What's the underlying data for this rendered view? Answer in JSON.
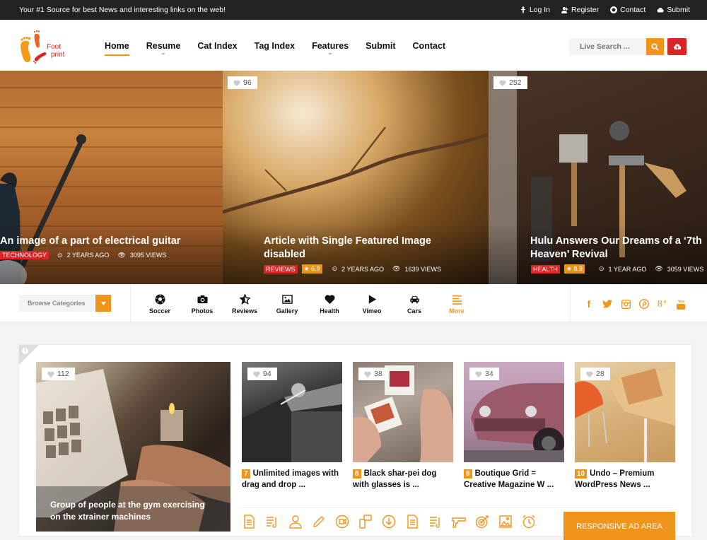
{
  "topbar": {
    "tagline": "Your #1 Source for best News and interesting links on the web!",
    "links": [
      {
        "icon": "login-icon",
        "label": "Log In"
      },
      {
        "icon": "register-icon",
        "label": "Register"
      },
      {
        "icon": "lifebuoy-icon",
        "label": "Contact"
      },
      {
        "icon": "cloud-upload-icon",
        "label": "Submit"
      }
    ]
  },
  "header": {
    "logo": {
      "line1": "Foot",
      "line2": "print"
    },
    "nav": [
      {
        "label": "Home",
        "active": true,
        "dropdown": false
      },
      {
        "label": "Resume",
        "active": false,
        "dropdown": true
      },
      {
        "label": "Cat Index",
        "active": false,
        "dropdown": false
      },
      {
        "label": "Tag Index",
        "active": false,
        "dropdown": false
      },
      {
        "label": "Features",
        "active": false,
        "dropdown": true
      },
      {
        "label": "Submit",
        "active": false,
        "dropdown": false
      },
      {
        "label": "Contact",
        "active": false,
        "dropdown": false
      }
    ],
    "search": {
      "placeholder": "Live Search ...",
      "value": ""
    }
  },
  "hero": [
    {
      "title": "An image of a part of electrical guitar",
      "category": "TECHNOLOGY",
      "rating": null,
      "time": "2 YEARS AGO",
      "views": "3095 VIEWS",
      "likes": null
    },
    {
      "title": "Article with Single Featured Image disabled",
      "category": "REVIEWS",
      "rating": "6.9",
      "time": "2 YEARS AGO",
      "views": "1639 VIEWS",
      "likes": "96"
    },
    {
      "title": "Hulu Answers Our Dreams of a ‘7th Heaven’ Revival",
      "category": "HEALTH",
      "rating": "8.9",
      "time": "1 YEAR AGO",
      "views": "3059 VIEWS",
      "likes": "252"
    }
  ],
  "catbar": {
    "browse_label": "Browse Categories",
    "categories": [
      {
        "icon": "soccer-ball-icon",
        "label": "Soccer"
      },
      {
        "icon": "camera-icon",
        "label": "Photos"
      },
      {
        "icon": "star-icon",
        "label": "Reviews"
      },
      {
        "icon": "image-icon",
        "label": "Gallery"
      },
      {
        "icon": "heart-icon",
        "label": "Health"
      },
      {
        "icon": "play-icon",
        "label": "Vimeo"
      },
      {
        "icon": "car-icon",
        "label": "Cars"
      },
      {
        "icon": "menu-icon",
        "label": "More"
      }
    ],
    "social": [
      "facebook",
      "twitter",
      "instagram",
      "pinterest",
      "google-plus",
      "youtube"
    ]
  },
  "grid": {
    "featured": {
      "title": "Group of people at the gym exercising on the xtrainer machines",
      "likes": "112"
    },
    "items": [
      {
        "num": "7",
        "title": "Unlimited images with drag and drop ...",
        "likes": "94"
      },
      {
        "num": "8",
        "title": "Black shar-pei dog with glasses is ...",
        "likes": "38"
      },
      {
        "num": "9",
        "title": "Boutique Grid = Creative Magazine W ...",
        "likes": "34"
      },
      {
        "num": "10",
        "title": "Undo – Premium WordPress News ...",
        "likes": "28"
      }
    ],
    "icons": [
      "document-icon",
      "music-list-icon",
      "user-icon",
      "pencil-icon",
      "video-icon",
      "mobile-chat-icon",
      "download-icon",
      "document-icon",
      "music-list-icon",
      "gun-icon",
      "target-icon",
      "picture-icon",
      "alarm-clock-icon"
    ],
    "ad_label": "RESPONSIVE AD AREA"
  },
  "colors": {
    "accent": "#f0951b",
    "danger": "#d92525",
    "topbar": "#222222"
  }
}
